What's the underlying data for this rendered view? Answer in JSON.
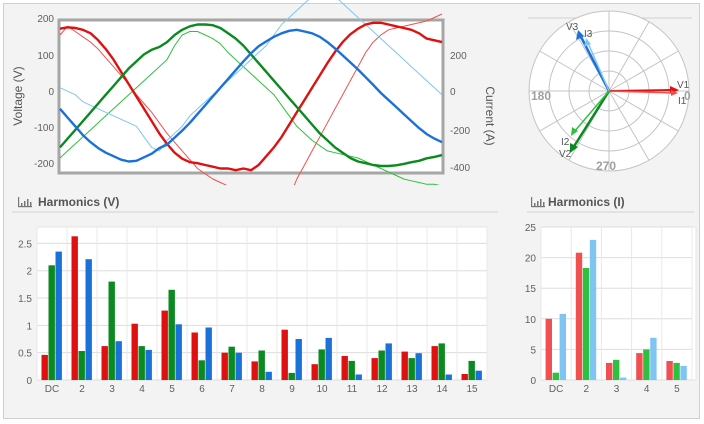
{
  "colors": {
    "r": "#e01010",
    "g": "#0a8a20",
    "b": "#1a72d8",
    "rl": "#f05050",
    "gl": "#30c040",
    "bl": "#80c4f4",
    "grid": "#dddddd"
  },
  "waveform": {
    "voltage_axis_label": "Voltage (V)",
    "current_axis_label": "Current (A)",
    "voltage_ticks": [
      "200",
      "100",
      "0",
      "-100",
      "-200"
    ],
    "current_ticks": [
      "200",
      "0",
      "-200",
      "-400"
    ]
  },
  "phasor": {
    "angle_labels": {
      "a0": "0",
      "a180": "180",
      "a270": "270"
    },
    "labels": {
      "v1": "V1",
      "i1": "I1",
      "v2": "V2",
      "i2": "I2",
      "v3": "V3",
      "i3": "I3"
    }
  },
  "harmonics_v": {
    "title": "Harmonics (V)"
  },
  "harmonics_i": {
    "title": "Harmonics (I)"
  },
  "chart_data": [
    {
      "type": "line",
      "x": [
        0,
        10,
        20,
        30,
        40,
        50,
        60,
        70,
        80,
        90,
        100,
        110,
        120,
        130,
        140,
        150,
        160,
        170,
        180,
        190,
        200,
        210,
        220,
        230,
        240,
        250,
        260,
        270,
        280,
        290,
        300,
        310,
        320,
        330,
        340,
        350,
        360,
        370,
        380,
        390,
        400,
        410,
        420,
        430,
        440,
        450,
        460,
        470,
        480,
        490,
        500
      ],
      "yticks": [
        200,
        100,
        0,
        -100,
        -200
      ],
      "ylim": [
        -220,
        210
      ],
      "y2ticks": [
        200,
        0,
        -200,
        -400
      ],
      "ylabel": "Voltage (V)",
      "y2label": "Current (A)",
      "series": [
        {
          "name": "V1",
          "values": [
            188,
            192,
            190,
            185,
            175,
            155,
            130,
            100,
            65,
            30,
            -5,
            -40,
            -75,
            -110,
            -140,
            -165,
            -182,
            -192,
            -195,
            -200,
            -205,
            -210,
            -210,
            -215,
            -210,
            -215,
            -200,
            -175,
            -150,
            -120,
            -85,
            -50,
            -15,
            20,
            55,
            90,
            122,
            150,
            172,
            188,
            200,
            205,
            205,
            200,
            195,
            190,
            185,
            175,
            160,
            155,
            150
          ]
        },
        {
          "name": "V2",
          "values": [
            -150,
            -125,
            -100,
            -75,
            -50,
            -25,
            0,
            25,
            50,
            75,
            95,
            115,
            128,
            136,
            150,
            170,
            185,
            195,
            200,
            200,
            198,
            190,
            175,
            160,
            140,
            115,
            90,
            65,
            40,
            15,
            -10,
            -35,
            -60,
            -85,
            -110,
            -130,
            -150,
            -165,
            -180,
            -190,
            -195,
            -200,
            -203,
            -203,
            -201,
            -197,
            -192,
            -188,
            -181,
            -177,
            -172
          ]
        },
        {
          "name": "V3",
          "values": [
            -40,
            -65,
            -90,
            -115,
            -135,
            -152,
            -165,
            -175,
            -185,
            -190,
            -188,
            -178,
            -168,
            -152,
            -142,
            -122,
            -102,
            -80,
            -55,
            -30,
            -5,
            20,
            45,
            70,
            95,
            118,
            138,
            152,
            165,
            175,
            182,
            185,
            180,
            175,
            165,
            150,
            132,
            112,
            92,
            72,
            50,
            28,
            5,
            -15,
            -35,
            -55,
            -75,
            -95,
            -112,
            -125,
            -135
          ]
        },
        {
          "name": "I1",
          "values": [
            170,
            195,
            180,
            165,
            150,
            130,
            105,
            80,
            55,
            30,
            0,
            -25,
            -50,
            -80,
            -110,
            -135,
            -160,
            -185,
            -210,
            -225,
            -240,
            -250,
            -260,
            -265,
            -270,
            -275,
            -275,
            -280,
            -285,
            -290,
            -295,
            -240,
            -200,
            -160,
            -120,
            -80,
            -40,
            0,
            40,
            80,
            120,
            150,
            170,
            185,
            190,
            195,
            200,
            205,
            210,
            220,
            230
          ]
        },
        {
          "name": "I2",
          "values": [
            -180,
            -160,
            -140,
            -120,
            -100,
            -80,
            -60,
            -40,
            -20,
            0,
            20,
            40,
            60,
            80,
            100,
            140,
            170,
            180,
            180,
            170,
            160,
            145,
            120,
            100,
            80,
            60,
            40,
            20,
            0,
            -30,
            -60,
            -90,
            -110,
            -130,
            -145,
            -160,
            -165,
            -170,
            -175,
            -180,
            -190,
            -200,
            -210,
            -220,
            -230,
            -240,
            -245,
            -250,
            -255,
            -255,
            -260
          ]
        },
        {
          "name": "I3",
          "values": [
            20,
            10,
            0,
            -20,
            -30,
            -40,
            -50,
            -60,
            -70,
            -80,
            -90,
            -120,
            -150,
            -160,
            -130,
            -110,
            -90,
            -60,
            -40,
            -20,
            0,
            20,
            40,
            60,
            80,
            100,
            120,
            140,
            170,
            200,
            220,
            240,
            260,
            280,
            290,
            290,
            280,
            260,
            240,
            220,
            200,
            180,
            160,
            140,
            120,
            100,
            80,
            60,
            40,
            20,
            0
          ]
        }
      ]
    },
    {
      "type": "bar",
      "title": "Harmonics (V)",
      "categories": [
        "DC",
        "2",
        "3",
        "4",
        "5",
        "6",
        "7",
        "8",
        "9",
        "10",
        "11",
        "12",
        "13",
        "14",
        "15"
      ],
      "yticks": [
        "0",
        "0.5",
        "1",
        "1.5",
        "2",
        "2.5"
      ],
      "ylim": [
        0,
        2.8
      ],
      "series": [
        {
          "name": "V1",
          "values": [
            0.46,
            2.63,
            0.62,
            1.03,
            1.27,
            0.87,
            0.5,
            0.34,
            0.92,
            0.29,
            0.44,
            0.4,
            0.52,
            0.62,
            0.11
          ]
        },
        {
          "name": "V2",
          "values": [
            2.1,
            0.53,
            1.8,
            0.62,
            1.65,
            0.36,
            0.61,
            0.54,
            0.13,
            0.56,
            0.35,
            0.54,
            0.4,
            0.67,
            0.35
          ]
        },
        {
          "name": "V3",
          "values": [
            2.35,
            2.21,
            0.71,
            0.55,
            1.02,
            0.96,
            0.5,
            0.15,
            0.75,
            0.77,
            0.1,
            0.67,
            0.49,
            0.1,
            0.17
          ]
        }
      ]
    },
    {
      "type": "bar",
      "title": "Harmonics (I)",
      "categories": [
        "DC",
        "2",
        "3",
        "4",
        "5"
      ],
      "yticks": [
        "0",
        "5",
        "10",
        "15",
        "20",
        "25"
      ],
      "ylim": [
        0,
        25
      ],
      "series": [
        {
          "name": "I1",
          "values": [
            10.0,
            20.8,
            2.8,
            4.4,
            3.1
          ]
        },
        {
          "name": "I2",
          "values": [
            1.2,
            18.3,
            3.3,
            5.0,
            2.8
          ]
        },
        {
          "name": "I3",
          "values": [
            10.8,
            22.9,
            0.4,
            6.9,
            2.3
          ]
        }
      ]
    }
  ]
}
